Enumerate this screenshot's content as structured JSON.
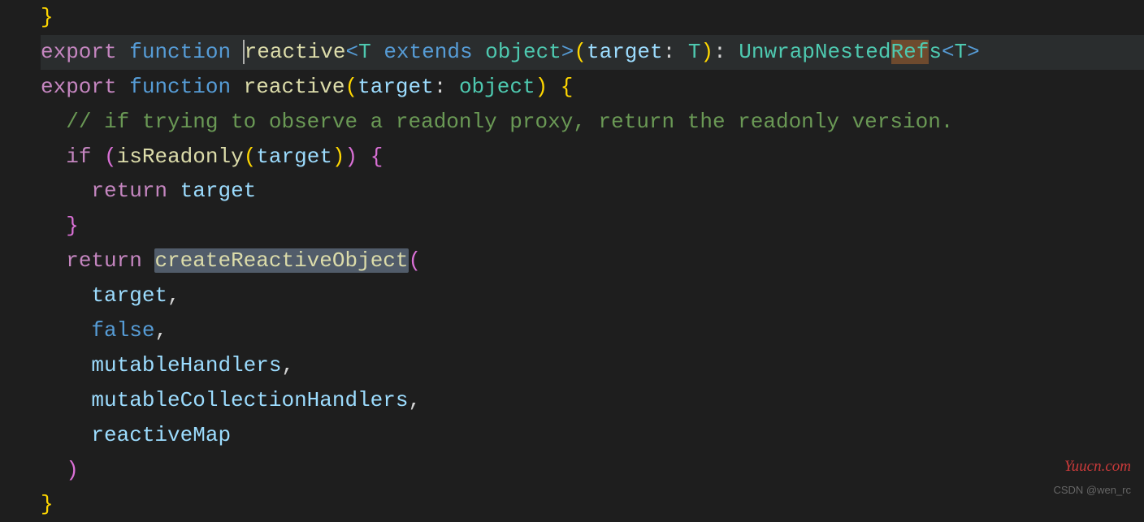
{
  "code": {
    "tokens": {
      "export": "export",
      "function": "function",
      "reactive": "reactive",
      "extends": "extends",
      "object": "object",
      "target": "target",
      "T": "T",
      "UnwrapNestedRefs": "UnwrapNestedRefs",
      "if": "if",
      "return": "return",
      "false": "false",
      "isReadonly": "isReadonly",
      "createReactiveObject": "createReactiveObject",
      "mutableHandlers": "mutableHandlers",
      "mutableCollectionHandlers": "mutableCollectionHandlers",
      "reactiveMap": "reactiveMap"
    },
    "comment": "// if trying to observe a readonly proxy, return the readonly version.",
    "punct": {
      "lt": "<",
      "gt": ">",
      "lp": "(",
      "rp": ")",
      "lb": "{",
      "rb": "}",
      "colon": ":",
      "comma": ","
    }
  },
  "watermarks": {
    "site": "Yuucn.com",
    "author": "CSDN @wen_rc"
  }
}
